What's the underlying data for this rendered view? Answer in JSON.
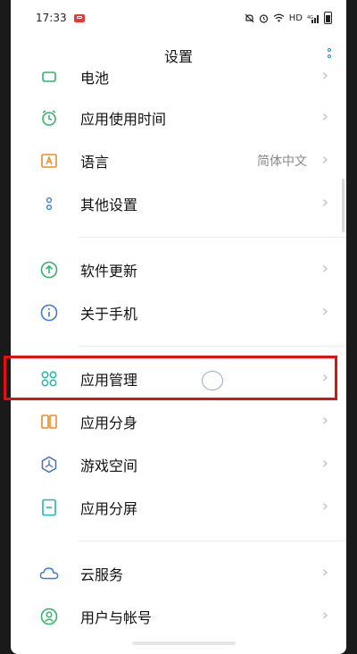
{
  "status_bar": {
    "time": "17:33",
    "network": "HD",
    "signal_label": "4G",
    "icons": [
      "notification-badge-icon",
      "mute-icon",
      "alarm-icon",
      "wifi-icon",
      "signal-icon",
      "battery-icon"
    ]
  },
  "header": {
    "title": "设置",
    "more_icon": "more-vertical-icon"
  },
  "accent_color": "#2a7fde",
  "highlight_color": "#e01010",
  "items": [
    {
      "label": "电池",
      "icon": "battery-green-icon"
    },
    {
      "label": "应用使用时间",
      "icon": "app-timer-icon"
    },
    {
      "label": "语言",
      "icon": "language-icon",
      "value": "简体中文"
    },
    {
      "label": "其他设置",
      "icon": "other-settings-icon"
    },
    {
      "label": "软件更新",
      "icon": "update-icon"
    },
    {
      "label": "关于手机",
      "icon": "info-icon"
    },
    {
      "label": "应用管理",
      "icon": "app-manage-icon"
    },
    {
      "label": "应用分身",
      "icon": "dual-apps-icon"
    },
    {
      "label": "游戏空间",
      "icon": "game-space-icon"
    },
    {
      "label": "应用分屏",
      "icon": "split-screen-icon"
    },
    {
      "label": "云服务",
      "icon": "cloud-icon"
    },
    {
      "label": "用户与帐号",
      "icon": "user-account-icon"
    }
  ],
  "chevron": "›"
}
